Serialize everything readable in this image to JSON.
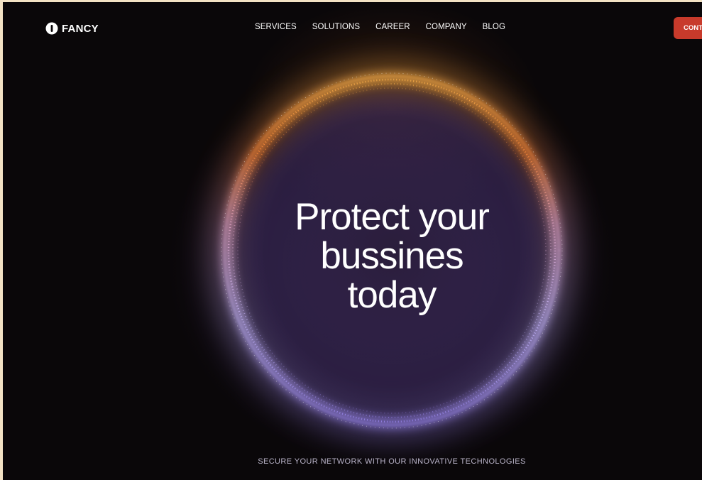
{
  "brand": {
    "name": "FANCY",
    "logo_icon": "fancy-logo-icon"
  },
  "nav": {
    "items": [
      {
        "label": "SERVICES"
      },
      {
        "label": "SOLUTIONS"
      },
      {
        "label": "CAREER"
      },
      {
        "label": "COMPANY"
      },
      {
        "label": "BLOG"
      }
    ]
  },
  "cta": {
    "label": "CONT"
  },
  "hero": {
    "headline_lines": [
      "Protect your",
      "bussines",
      "today"
    ],
    "tagline": "SECURE YOUR NETWORK WITH OUR INNOVATIVE TECHNOLOGIES"
  },
  "colors": {
    "background": "#0a0709",
    "cta": "#c83a2b",
    "orb_top": "#ff9a2e",
    "orb_bottom": "#b6a4ff",
    "text": "#ffffff",
    "tagline": "#b9b3c8"
  }
}
